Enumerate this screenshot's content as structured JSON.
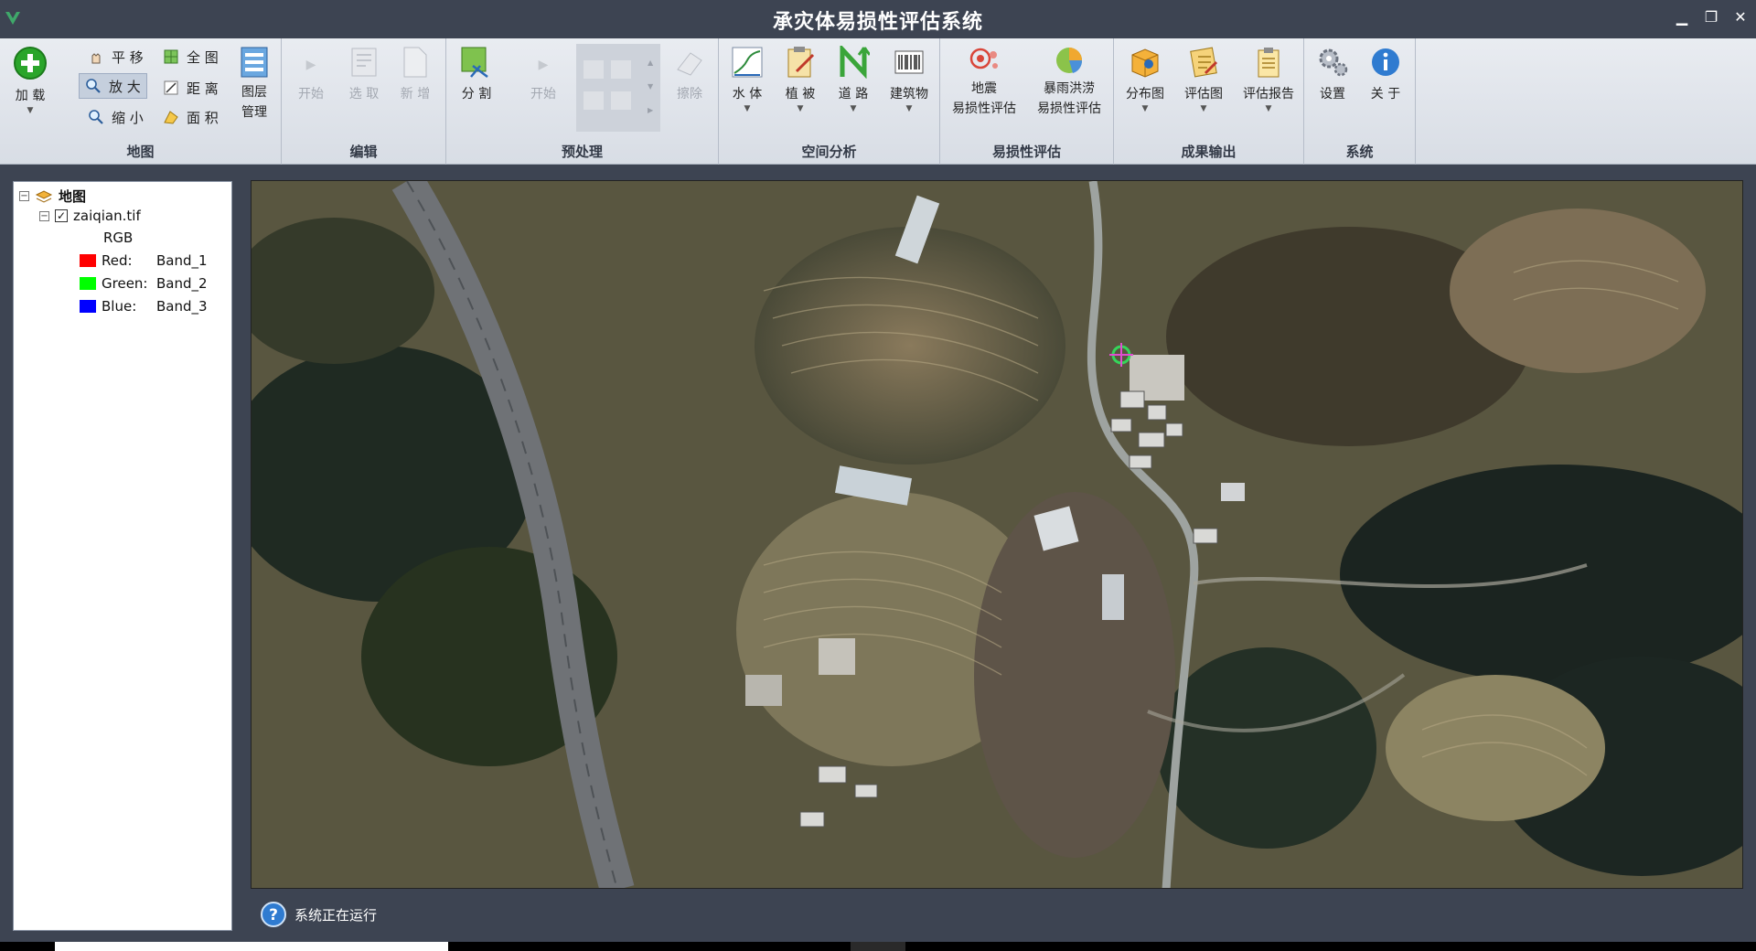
{
  "window": {
    "title": "承灾体易损性评估系统",
    "minimize": "▁",
    "restore": "❐",
    "close": "✕"
  },
  "ribbon": {
    "map_group": {
      "label": "地图",
      "load": "加 载",
      "pan": "平 移",
      "zoom_in": "放 大",
      "zoom_out": "缩 小",
      "full_extent": "全 图",
      "distance": "距 离",
      "area": "面 积",
      "layer_manage_1": "图层",
      "layer_manage_2": "管理"
    },
    "edit_group": {
      "label": "编辑",
      "start": "开始",
      "select": "选 取",
      "add": "新 增"
    },
    "preprocess_group": {
      "label": "预处理",
      "split": "分 割",
      "start": "开始",
      "erase": "擦除"
    },
    "spatial_group": {
      "label": "空间分析",
      "water": "水 体",
      "vegetation": "植 被",
      "road": "道 路",
      "building": "建筑物"
    },
    "vuln_group": {
      "label": "易损性评估",
      "eq_1": "地震",
      "eq_2": "易损性评估",
      "flood_1": "暴雨洪涝",
      "flood_2": "易损性评估"
    },
    "output_group": {
      "label": "成果输出",
      "distribution": "分布图",
      "assessment_map": "评估图",
      "report": "评估报告"
    },
    "system_group": {
      "label": "系统",
      "settings": "设置",
      "about": "关 于"
    }
  },
  "layers": {
    "root": "地图",
    "file": "zaiqian.tif",
    "mode": "RGB",
    "bands": [
      {
        "channel": "Red:",
        "band": "Band_1",
        "color": "#ff0000"
      },
      {
        "channel": "Green:",
        "band": "Band_2",
        "color": "#00ff00"
      },
      {
        "channel": "Blue:",
        "band": "Band_3",
        "color": "#0000ff"
      }
    ]
  },
  "status": {
    "text": "系统正在运行"
  },
  "colors": {
    "titlebar": "#3d4452",
    "ribbon": "#e3e7ed",
    "accent": "#2f7bd0"
  }
}
